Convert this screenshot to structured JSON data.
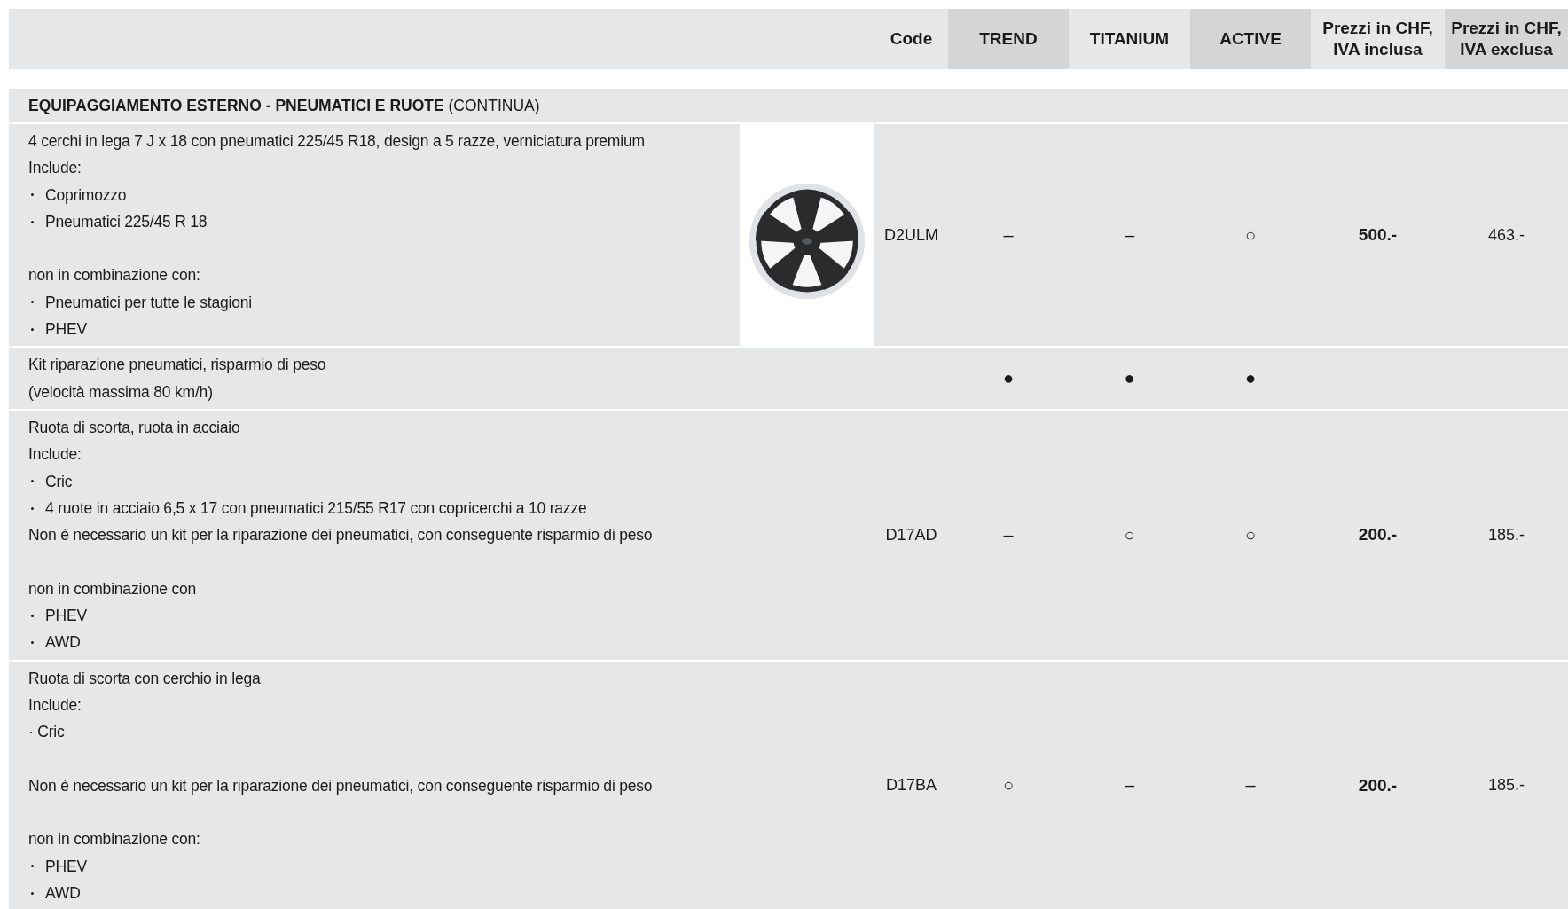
{
  "header": {
    "columns": [
      "Code",
      "TREND",
      "TITANIUM",
      "ACTIVE",
      "Prezzi in CHF, IVA inclusa",
      "Prezzi in CHF, IVA exclusa"
    ]
  },
  "section": {
    "title": "**EQUIPAGGIAMENTO ESTERNO - PNEUMATICI E RUOTE** (CONTINUA)"
  },
  "rows": [
    {
      "lines": [
        {
          "kind": "text",
          "text": "4 cerchi in lega 7 J x 18 con pneumatici 225/45 R18, design a 5 razze, verniciatura premium"
        },
        {
          "kind": "text",
          "text": "Include:"
        },
        {
          "kind": "bullet",
          "text": "Coprimozzo"
        },
        {
          "kind": "bullet",
          "text": "Pneumatici 225/45 R 18"
        },
        {
          "kind": "gap"
        },
        {
          "kind": "text",
          "text": "non in combinazione con:"
        },
        {
          "kind": "bullet",
          "text": "Pneumatici per tutte le stagioni"
        },
        {
          "kind": "bullet",
          "text": "PHEV"
        }
      ],
      "image": true,
      "code": "D2ULM",
      "trend": "–",
      "titanium": "–",
      "active": "○",
      "price_incl": "500.-",
      "price_excl": "463.-"
    },
    {
      "lines": [
        {
          "kind": "text",
          "text": "Kit riparazione pneumatici, risparmio di peso"
        },
        {
          "kind": "text",
          "text": "(velocità massima 80 km/h)"
        }
      ],
      "image": false,
      "trend": "●",
      "titanium": "●",
      "active": "●"
    },
    {
      "lines": [
        {
          "kind": "text",
          "text": "Ruota di scorta, ruota in acciaio"
        },
        {
          "kind": "text",
          "text": "Include:"
        },
        {
          "kind": "bullet",
          "text": "Cric"
        },
        {
          "kind": "bullet",
          "text": "4 ruote in acciaio 6,5 x 17 con pneumatici 215/55 R17 con copricerchi a 10 razze"
        },
        {
          "kind": "text",
          "text": "Non è necessario un kit per la riparazione dei pneumatici, con conseguente risparmio di peso"
        },
        {
          "kind": "gap"
        },
        {
          "kind": "text",
          "text": "non in combinazione con"
        },
        {
          "kind": "bullet",
          "text": "PHEV"
        },
        {
          "kind": "bullet",
          "text": "AWD"
        }
      ],
      "image": false,
      "code": "D17AD",
      "trend": "–",
      "titanium": "○",
      "active": "○",
      "price_incl": "200.-",
      "price_excl": "185.-"
    },
    {
      "lines": [
        {
          "kind": "text",
          "text": "Ruota di scorta con cerchio in lega"
        },
        {
          "kind": "text",
          "text": "Include:"
        },
        {
          "kind": "text",
          "text": "· Cric"
        },
        {
          "kind": "gap"
        },
        {
          "kind": "text",
          "text": "Non è necessario un kit per la riparazione dei pneumatici, con conseguente risparmio di peso"
        },
        {
          "kind": "gap"
        },
        {
          "kind": "text",
          "text": "non in combinazione con:"
        },
        {
          "kind": "bullet",
          "text": "PHEV"
        },
        {
          "kind": "bullet",
          "text": "AWD"
        }
      ],
      "image": false,
      "code": "D17BA",
      "trend": "○",
      "titanium": "–",
      "active": "–",
      "price_incl": "200.-",
      "price_excl": "185.-"
    }
  ]
}
